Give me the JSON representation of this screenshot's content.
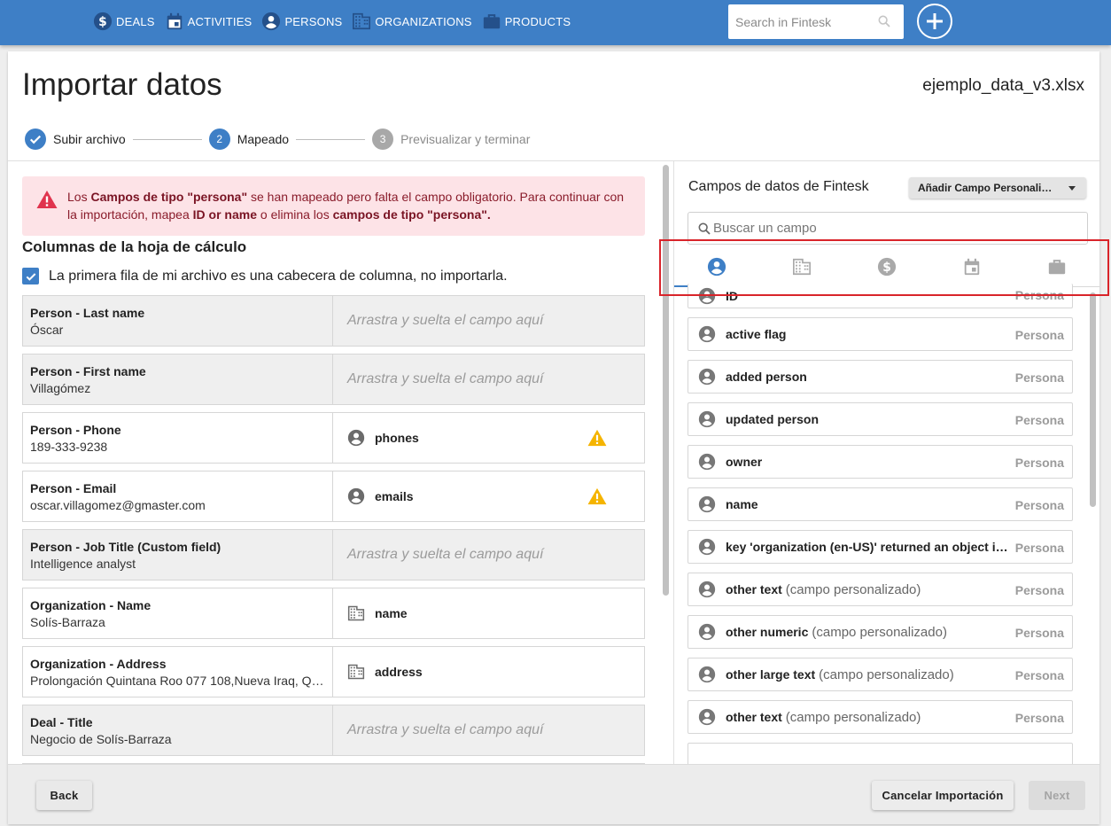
{
  "nav": {
    "items": [
      {
        "label": "DEALS",
        "icon": "dollar-icon"
      },
      {
        "label": "ACTIVITIES",
        "icon": "calendar-icon"
      },
      {
        "label": "PERSONS",
        "icon": "person-icon"
      },
      {
        "label": "ORGANIZATIONS",
        "icon": "building-icon"
      },
      {
        "label": "PRODUCTS",
        "icon": "briefcase-icon"
      }
    ],
    "search_placeholder": "Search in Fintesk"
  },
  "page": {
    "title": "Importar datos",
    "file_name": "ejemplo_data_v3.xlsx"
  },
  "stepper": {
    "steps": [
      {
        "label": "Subir archivo",
        "number": "",
        "state": "done"
      },
      {
        "label": "Mapeado",
        "number": "2",
        "state": "active"
      },
      {
        "label": "Previsualizar y terminar",
        "number": "3",
        "state": "pending"
      }
    ]
  },
  "alert": {
    "pre": "Los ",
    "b1": "Campos de tipo \"persona\"",
    "mid1": " se han mapeado pero falta el campo obligatorio. Para continuar con la importación, mapea ",
    "b2": "ID or name",
    "mid2": " o elimina los ",
    "b3": "campos de tipo \"persona\"."
  },
  "columns": {
    "title": "Columnas de la hoja de cálculo",
    "header_checkbox_label": "La primera fila de mi archivo es una cabecera de columna, no importarla.",
    "drop_placeholder": "Arrastra y suelta el campo aquí",
    "rows": [
      {
        "name": "Person - Last name",
        "sample": "Óscar",
        "mapped": "",
        "icon": ""
      },
      {
        "name": "Person - First name",
        "sample": "Villagómez",
        "mapped": "",
        "icon": ""
      },
      {
        "name": "Person - Phone",
        "sample": "189-333-9238",
        "mapped": "phones",
        "icon": "person-icon",
        "warning": true
      },
      {
        "name": "Person - Email",
        "sample": "oscar.villagomez@gmaster.com",
        "mapped": "emails",
        "icon": "person-icon",
        "warning": true
      },
      {
        "name": "Person - Job Title (Custom field)",
        "sample": "Intelligence analyst",
        "mapped": "",
        "icon": ""
      },
      {
        "name": "Organization - Name",
        "sample": "Solís-Barraza",
        "mapped": "name",
        "icon": "building-icon"
      },
      {
        "name": "Organization - Address",
        "sample": "Prolongación Quintana Roo 077 108,Nueva Iraq, Queretaro",
        "mapped": "address",
        "icon": "building-icon"
      },
      {
        "name": "Deal - Title",
        "sample": "Negocio de Solís-Barraza",
        "mapped": "",
        "icon": ""
      }
    ]
  },
  "fields_panel": {
    "title": "Campos de datos de Fintesk",
    "add_custom_label": "Añadir Campo Personalizado",
    "search_placeholder": "Buscar un campo",
    "tabs": [
      {
        "name": "person",
        "icon": "person-icon",
        "active": true
      },
      {
        "name": "organization",
        "icon": "building-icon",
        "active": false
      },
      {
        "name": "deal",
        "icon": "dollar-icon",
        "active": false
      },
      {
        "name": "activity",
        "icon": "calendar-icon",
        "active": false
      },
      {
        "name": "product",
        "icon": "briefcase-icon",
        "active": false
      }
    ],
    "items": [
      {
        "name": "ID",
        "note": "",
        "type": "Persona"
      },
      {
        "name": "active flag",
        "note": "",
        "type": "Persona"
      },
      {
        "name": "added person",
        "note": "",
        "type": "Persona"
      },
      {
        "name": "updated person",
        "note": "",
        "type": "Persona"
      },
      {
        "name": "owner",
        "note": "",
        "type": "Persona"
      },
      {
        "name": "name",
        "note": "",
        "type": "Persona"
      },
      {
        "name": "key 'organization (en-US)' returned an object instead of string.",
        "note": "",
        "type": "Persona"
      },
      {
        "name": "other text",
        "note": "(campo personalizado)",
        "type": "Persona"
      },
      {
        "name": "other numeric",
        "note": "(campo personalizado)",
        "type": "Persona"
      },
      {
        "name": "other large text",
        "note": "(campo personalizado)",
        "type": "Persona"
      },
      {
        "name": "other text",
        "note": "(campo personalizado)",
        "type": "Persona"
      }
    ]
  },
  "footer": {
    "back_label": "Back",
    "cancel_label": "Cancelar Importación",
    "next_label": "Next"
  },
  "colors": {
    "primary": "#3e7fc6",
    "alert_bg": "#fde3e7",
    "alert_icon": "#e0344e",
    "warning": "#f5b400",
    "highlight": "#d9242a"
  }
}
